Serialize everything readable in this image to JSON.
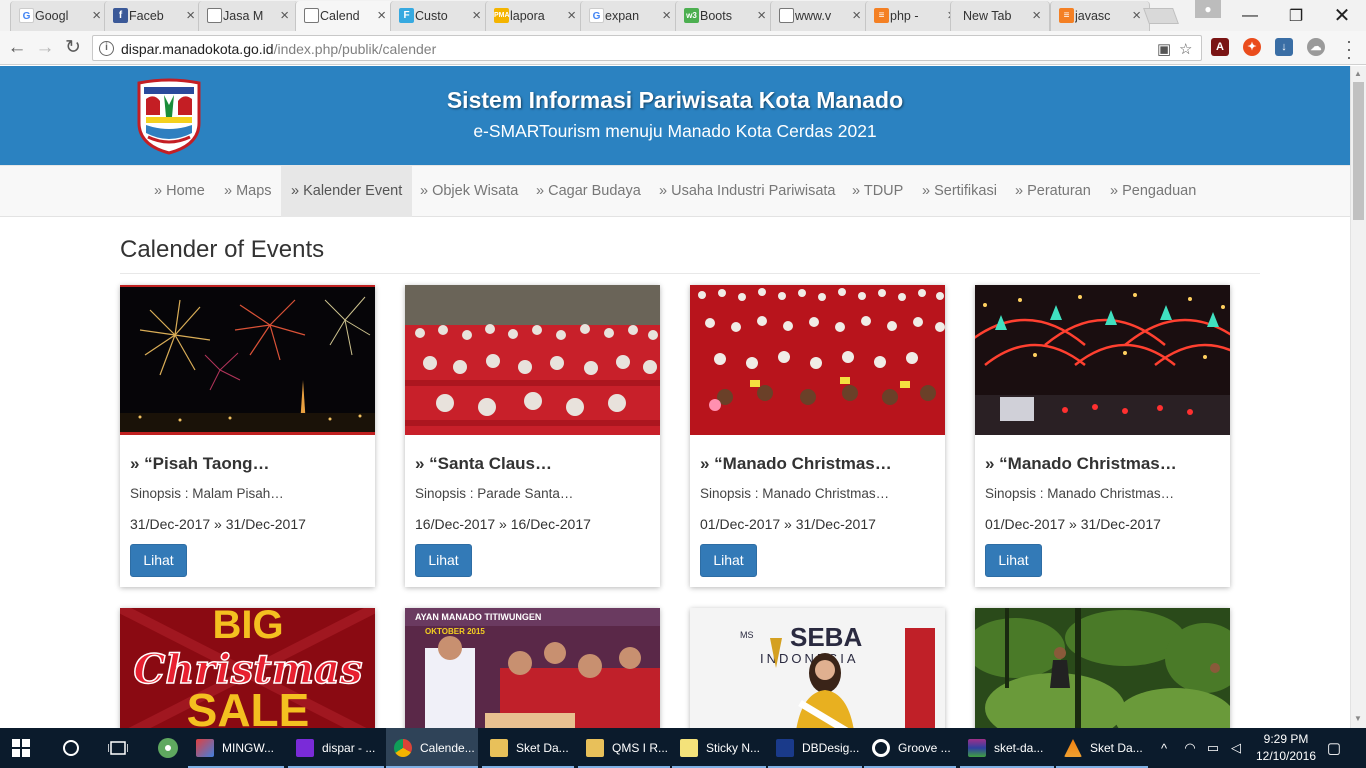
{
  "browser": {
    "tabs": [
      {
        "label": "Googl",
        "favicon": "google-icon"
      },
      {
        "label": "Faceb",
        "favicon": "facebook-icon"
      },
      {
        "label": "Jasa M",
        "favicon": "page-icon"
      },
      {
        "label": "Calend",
        "favicon": "page-icon",
        "active": true
      },
      {
        "label": "Custo",
        "favicon": "f-icon"
      },
      {
        "label": "lapora",
        "favicon": "pma-icon"
      },
      {
        "label": "expan",
        "favicon": "google-icon"
      },
      {
        "label": "Boots",
        "favicon": "w3-icon"
      },
      {
        "label": "www.v",
        "favicon": "page-icon"
      },
      {
        "label": "php -",
        "favicon": "stack-icon"
      },
      {
        "label": "New Tab",
        "favicon": ""
      },
      {
        "label": "javasc",
        "favicon": "stack-icon"
      }
    ],
    "address": {
      "host": "dispar.manadokota.go.id",
      "path": "/index.php/publik/calender"
    }
  },
  "site": {
    "title": "Sistem Informasi Pariwisata Kota Manado",
    "subtitle": "e-SMARTourism menuju Manado Kota Cerdas 2021",
    "nav": [
      {
        "label": "» Home"
      },
      {
        "label": "» Maps"
      },
      {
        "label": "» Kalender Event",
        "active": true
      },
      {
        "label": "» Objek Wisata"
      },
      {
        "label": "» Cagar Budaya"
      },
      {
        "label": "» Usaha Industri Pariwisata"
      },
      {
        "label": "» TDUP"
      },
      {
        "label": "» Sertifikasi"
      },
      {
        "label": "» Peraturan"
      },
      {
        "label": "» Pengaduan"
      }
    ]
  },
  "events": {
    "heading": "Calender of Events",
    "button_label": "Lihat",
    "cards": [
      {
        "title": "» “Pisah Taong…",
        "synopsis": "Sinopsis : Malam Pisah…",
        "dates": "31/Dec-2017 » 31/Dec-2017"
      },
      {
        "title": "» “Santa Claus…",
        "synopsis": "Sinopsis : Parade Santa…",
        "dates": "16/Dec-2017 » 16/Dec-2017"
      },
      {
        "title": "» “Manado Christmas…",
        "synopsis": "Sinopsis : Manado Christmas…",
        "dates": "01/Dec-2017 » 31/Dec-2017"
      },
      {
        "title": "» “Manado Christmas…",
        "synopsis": "Sinopsis : Manado Christmas…",
        "dates": "01/Dec-2017 » 31/Dec-2017"
      }
    ],
    "second_row": {
      "sale_big": "BIG",
      "sale_christmas": "Christmas",
      "sale_word": "SALE",
      "banner_text": "AYAN MANADO TITIWUNGEN",
      "banner_date": "OKTOBER 2015",
      "pageant_logo": "SEBA",
      "pageant_sub": "INDONESIA",
      "pageant_ms": "MS"
    }
  },
  "taskbar": {
    "apps": [
      {
        "label": "MINGW...",
        "icon": "git-icon"
      },
      {
        "label": "dispar - ...",
        "icon": "phpstorm-icon"
      },
      {
        "label": "Calende...",
        "icon": "chrome-icon",
        "active": true
      },
      {
        "label": "Sket Da...",
        "icon": "folder-icon"
      },
      {
        "label": "QMS I R...",
        "icon": "folder-icon"
      },
      {
        "label": "Sticky N...",
        "icon": "sticky-notes-icon"
      },
      {
        "label": "DBDesig...",
        "icon": "dbdesigner-icon"
      },
      {
        "label": "Groove ...",
        "icon": "groove-icon"
      },
      {
        "label": "sket-da...",
        "icon": "winrar-icon"
      },
      {
        "label": "Sket Da...",
        "icon": "vlc-icon"
      }
    ],
    "time": "9:29 PM",
    "date": "12/10/2016"
  },
  "colors": {
    "header": "#2b82c1",
    "button": "#337ab7",
    "taskbar": "#0b1b2c"
  }
}
